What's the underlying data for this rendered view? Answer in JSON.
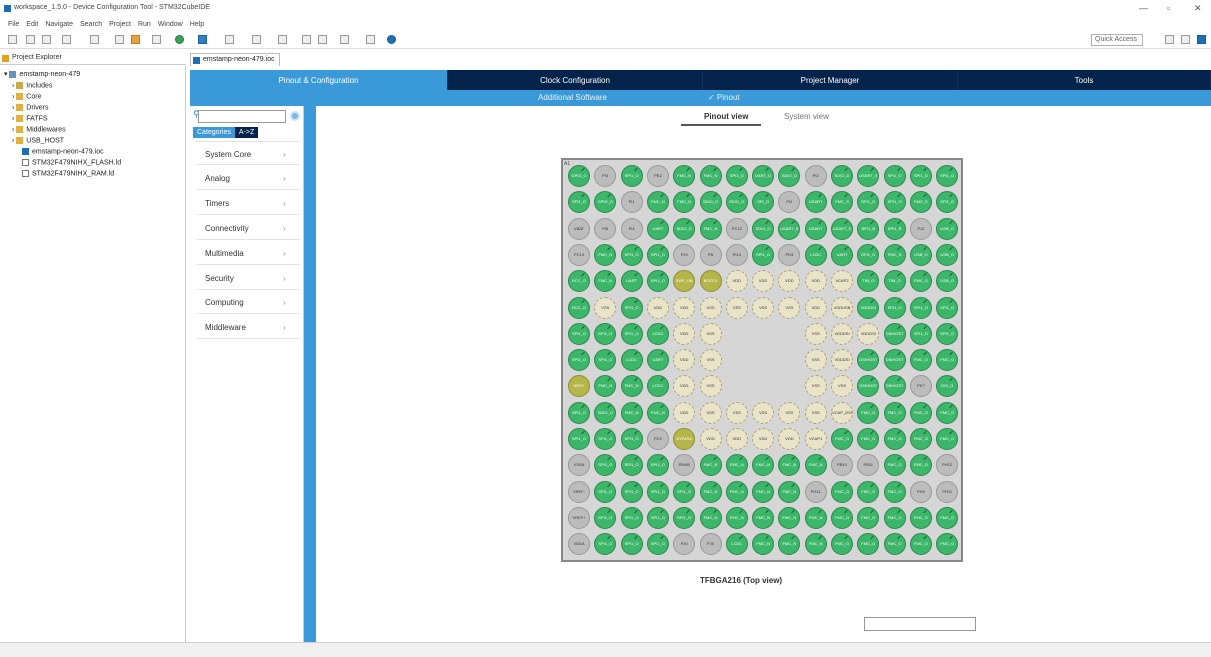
{
  "window": {
    "title": "workspace_1.5.0 - Device Configuration Tool - STM32CubeIDE",
    "controls": [
      "—",
      "▫",
      "✕"
    ]
  },
  "menu": [
    "File",
    "Edit",
    "Navigate",
    "Search",
    "Project",
    "Run",
    "Window",
    "Help"
  ],
  "toolbar": {
    "quick_access_placeholder": "Quick Access"
  },
  "project_explorer": {
    "tab_label": "Project Explorer",
    "tree": [
      {
        "label": "emstamp-neon-479",
        "indent": 0,
        "icon": "project-icon",
        "expanded": true
      },
      {
        "label": "Includes",
        "indent": 1,
        "icon": "includes-icon"
      },
      {
        "label": "Core",
        "indent": 1,
        "icon": "folder-icon"
      },
      {
        "label": "Drivers",
        "indent": 1,
        "icon": "folder-icon"
      },
      {
        "label": "FATFS",
        "indent": 1,
        "icon": "folder-icon"
      },
      {
        "label": "Middlewares",
        "indent": 1,
        "icon": "folder-icon"
      },
      {
        "label": "USB_HOST",
        "indent": 1,
        "icon": "folder-icon"
      },
      {
        "label": "emstamp-neon-479.ioc",
        "indent": 1,
        "icon": "ioc-file-icon"
      },
      {
        "label": "STM32F479NIHX_FLASH.ld",
        "indent": 1,
        "icon": "ld-file-icon"
      },
      {
        "label": "STM32F479NIHX_RAM.ld",
        "indent": 1,
        "icon": "ld-file-icon"
      }
    ]
  },
  "editor": {
    "tab_label": "emstamp-neon-479.ioc",
    "main_tabs": [
      {
        "label": "Pinout & Configuration",
        "active": true
      },
      {
        "label": "Clock Configuration",
        "active": false
      },
      {
        "label": "Project Manager",
        "active": false
      },
      {
        "label": "Tools",
        "active": false
      }
    ],
    "sub_bar": {
      "additional_software": "Additional Software",
      "pinout": "✓ Pinout"
    },
    "categories": {
      "tab_categories": "Categories",
      "tab_az": "A->Z",
      "items": [
        "System Core",
        "Analog",
        "Timers",
        "Connectivity",
        "Multimedia",
        "Security",
        "Computing",
        "Middleware"
      ]
    },
    "view_tabs": {
      "pinout_view": "Pinout view",
      "system_view": "System view"
    },
    "chip_label": "TFBGA216 (Top view)"
  },
  "chip": {
    "corner_mark": "A1",
    "rows": [
      [
        "g:GPIO_O",
        "gr:PI3",
        "g:SPI1_O",
        "gr:PE2",
        "g:FMC_N",
        "g:FMC_N",
        "g:SPI1_O",
        "g:UART_O",
        "g:SDIO_O",
        "gr:PI2",
        "g:SDIO_D",
        "g:USART_S",
        "g:SPI1_O",
        "g:SPI1_O",
        "g:SPI1_O"
      ],
      [
        "g:SPI1_O",
        "g:GPIO_O",
        "gr:PI1",
        "g:FMC_N",
        "g:FMC_N",
        "g:SDIO_O",
        "g:SDIO_O",
        "g:SPI_O",
        "gr:PI4",
        "g:USART",
        "g:FMC_S",
        "g:SPI1_O",
        "g:SPI1_O",
        "g:FMC_S",
        "g:SPI1_O"
      ],
      [
        "gr:VBAT",
        "gr:PI8",
        "gr:PI4",
        "g:UART",
        "g:SDIO_O",
        "g:FMC_N",
        "gr:PC12",
        "g:SDIO_O",
        "g:USART_B",
        "g:USART",
        "g:USART_S",
        "g:SPI1_B",
        "g:SPI1_B",
        "gr:PJ2",
        "g:USB_O"
      ],
      [
        "gr:PC13",
        "g:FMC_N",
        "g:SPI1_O",
        "g:SPI1_O",
        "gr:PJ3",
        "gr:PB",
        "gr:PI14",
        "g:SPI1_O",
        "gr:PD3",
        "g:LCDC",
        "g:UART",
        "g:SPI1_O",
        "g:FMC_S",
        "g:USB_O",
        "g:USB_O"
      ],
      [
        "g:RCC_O",
        "g:FMC_N",
        "g:UART",
        "g:SPI1_O",
        "y:SWP_DB",
        "y:BOOT0",
        "pw:VDD",
        "pw:VDD",
        "pw:VDD",
        "pw:VDD",
        "pw:VCAP2",
        "g:TIM_O",
        "g:TIM_O",
        "g:FMC_S",
        "g:USB_O"
      ],
      [
        "g:RCC_O",
        "pw:VSS",
        "g:SPI1_O",
        "pw:VDD",
        "pw:VDD",
        "pw:VSS",
        "pw:VSS",
        "pw:VSS",
        "pw:VSS",
        "pw:VDD",
        "pw:VDDUSB",
        "g:VDDDSI",
        "g:SPI1_O",
        "g:SPI1_O",
        "g:SPI1_O"
      ],
      [
        "g:SPI1_O",
        "g:SPI1_O",
        "g:SPI1_O",
        "g:LCDC",
        "pw:VDD",
        "pw:VSS",
        "",
        "",
        "",
        "pw:VSS",
        "pw:VDDDSI",
        "pw:VDDDSI",
        "g:DSIHOST",
        "g:SPI1_O",
        "g:SPI1_O"
      ],
      [
        "g:SPI1_O",
        "g:SPI1_O",
        "g:LCDC",
        "g:UART",
        "pw:VDD",
        "pw:VSS",
        "",
        "",
        "",
        "pw:VSS",
        "pw:VDDDSI",
        "g:DSIHOST",
        "g:DSIHOST",
        "g:FMC_O",
        "g:FMC_O"
      ],
      [
        "y:NRST",
        "g:FMC_N",
        "g:FMC_N",
        "g:LCDC",
        "pw:VDD",
        "pw:VSS",
        "",
        "",
        "",
        "pw:VSS",
        "pw:VSS",
        "g:DSIHOST",
        "g:DSIHOST",
        "gr:PK7",
        "g:DSI_O"
      ],
      [
        "g:SPI1_O",
        "g:SDIO_O",
        "g:FMC_N",
        "g:FMC_N",
        "pw:VDD",
        "pw:VSS",
        "pw:VSS",
        "pw:VSS",
        "pw:VSS",
        "pw:VSS",
        "pw:VCAP_DSI",
        "g:FMC_O",
        "g:FMC_O",
        "g:FMC_O",
        "g:FMC_O"
      ],
      [
        "g:SPI1_O",
        "g:SPI1_O",
        "g:SPI1_O",
        "gr:PC3",
        "y:BYPASS",
        "pw:VDD",
        "pw:VDD",
        "pw:VDD",
        "pw:VDD",
        "pw:VCAP1",
        "g:FMC_O",
        "g:FMC_O",
        "g:FMC_O",
        "g:FMC_O",
        "g:FMC_O"
      ],
      [
        "gr:VSSA",
        "g:SPI1_O",
        "g:SPI1_O",
        "g:SPI1_O",
        "gr:PB4/B",
        "g:FMC_N",
        "g:FMC_N",
        "g:FMC_N",
        "g:FMC_N",
        "g:FMC_N",
        "gr:PB10",
        "gr:PB11",
        "g:FMC_O",
        "g:FMC_O",
        "gr:PH12"
      ],
      [
        "gr:VREF-",
        "g:SPI1_O",
        "g:SPI1_O",
        "g:SPI1_O",
        "g:SPI1_O",
        "g:FMC_N",
        "g:FMC_N",
        "g:FMC_N",
        "g:FMC_N",
        "gr:PG11",
        "g:FMC_O",
        "g:FMC_O",
        "g:FMC_O",
        "gr:PH9",
        "gr:PH11"
      ],
      [
        "gr:VREF+",
        "g:SPI1_O",
        "g:SPI1_O",
        "g:SPI1_O",
        "g:SPI1_O",
        "g:FMC_N",
        "g:FMC_N",
        "g:FMC_N",
        "g:FMC_N",
        "g:FMC_N",
        "g:FMC_O",
        "g:FMC_O",
        "g:FMC_O",
        "g:FMC_O",
        "g:FMC_O"
      ],
      [
        "gr:VDDA",
        "g:SPI1_O",
        "g:SPI1_O",
        "g:SPI1_O",
        "gr:PJ0",
        "gr:PJ0",
        "g:LCDC",
        "g:FMC_N",
        "g:FMC_N",
        "g:FMC_N",
        "g:FMC_O",
        "g:FMC_O",
        "g:FMC_O",
        "g:FMC_O",
        "g:FMC_O"
      ]
    ]
  }
}
